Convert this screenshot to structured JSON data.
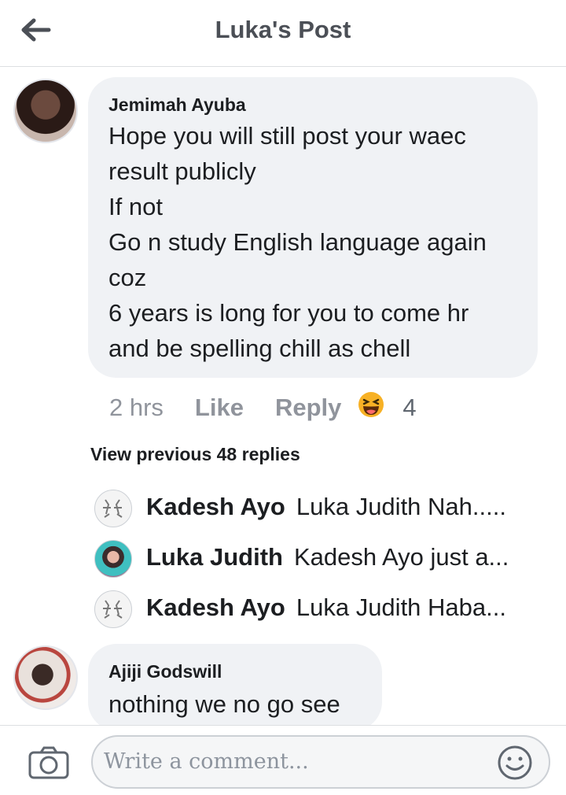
{
  "header": {
    "title": "Luka's Post"
  },
  "comment1": {
    "author": "Jemimah Ayuba",
    "text": "Hope you will still post your waec\nresult publicly\nIf not\nGo n study English language again\ncoz\n6 years is long for you to come hr\nand be spelling chill as chell",
    "time": "2 hrs",
    "like_label": "Like",
    "reply_label": "Reply",
    "reaction_icon": "laughing-emoji-icon",
    "reaction_count": "4"
  },
  "view_previous": "View previous 48 replies",
  "replies": [
    {
      "author": "Kadesh Ayo",
      "text": "Luka Judith Nah....."
    },
    {
      "author": "Luka Judith",
      "text": "Kadesh Ayo just a..."
    },
    {
      "author": "Kadesh Ayo",
      "text": "Luka Judith Haba..."
    }
  ],
  "comment2": {
    "author": "Ajiji Godswill",
    "text": "nothing we no go see"
  },
  "composer": {
    "placeholder": "Write a comment..."
  },
  "colors": {
    "bubble": "#f0f2f5",
    "meta": "#90949c",
    "reaction": "#f7b125"
  }
}
